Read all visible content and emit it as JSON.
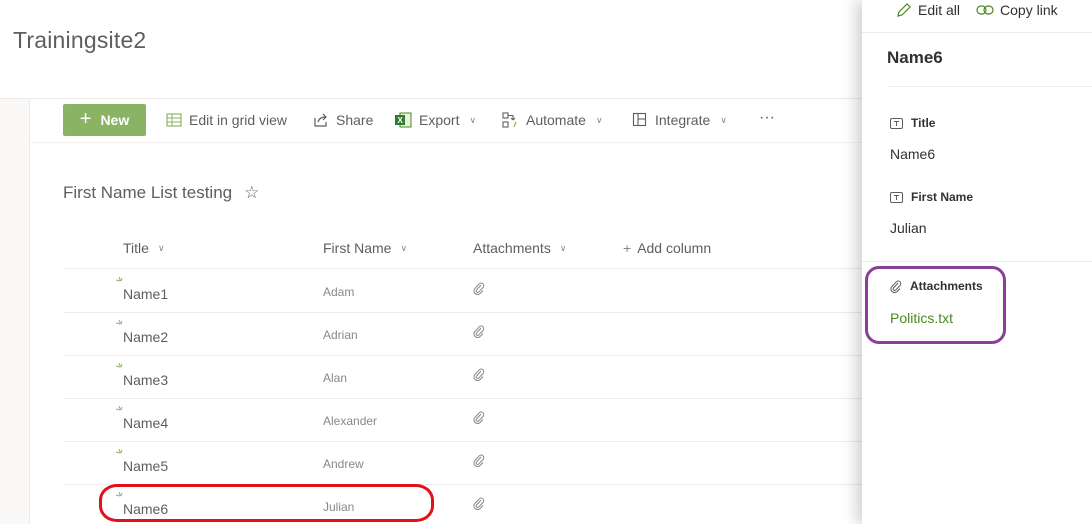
{
  "site": {
    "title": "Trainingsite2"
  },
  "commandbar": {
    "new": "New",
    "edit_grid": "Edit in grid view",
    "share": "Share",
    "export": "Export",
    "automate": "Automate",
    "integrate": "Integrate",
    "more": "···"
  },
  "list": {
    "title": "First Name List testing",
    "columns": {
      "title": "Title",
      "first_name": "First Name",
      "attachments": "Attachments",
      "add_column": "Add column"
    },
    "rows": [
      {
        "title": "Name1",
        "first_name": "Adam"
      },
      {
        "title": "Name2",
        "first_name": "Adrian"
      },
      {
        "title": "Name3",
        "first_name": "Alan"
      },
      {
        "title": "Name4",
        "first_name": "Alexander"
      },
      {
        "title": "Name5",
        "first_name": "Andrew"
      },
      {
        "title": "Name6",
        "first_name": "Julian"
      }
    ]
  },
  "pane": {
    "edit_all": "Edit all",
    "copy_link": "Copy link",
    "title": "Name6",
    "fields": {
      "title_label": "Title",
      "title_value": "Name6",
      "first_name_label": "First Name",
      "first_name_value": "Julian",
      "attachments_label": "Attachments",
      "attachment_file": "Politics.txt"
    }
  },
  "colors": {
    "accent_green": "#8ab363",
    "link_green": "#4a8a1e",
    "annotation_red": "#e3101b",
    "annotation_purple": "#8b3f9b"
  },
  "icons": {
    "new": "plus-icon",
    "edit_grid": "grid-icon",
    "share": "share-icon",
    "export": "excel-icon",
    "automate": "flow-icon",
    "integrate": "integrate-icon",
    "favorite": "star-icon",
    "attachment": "paperclip-icon",
    "edit_all": "pencil-icon",
    "copy_link": "link-icon",
    "text_field": "text-field-icon"
  }
}
